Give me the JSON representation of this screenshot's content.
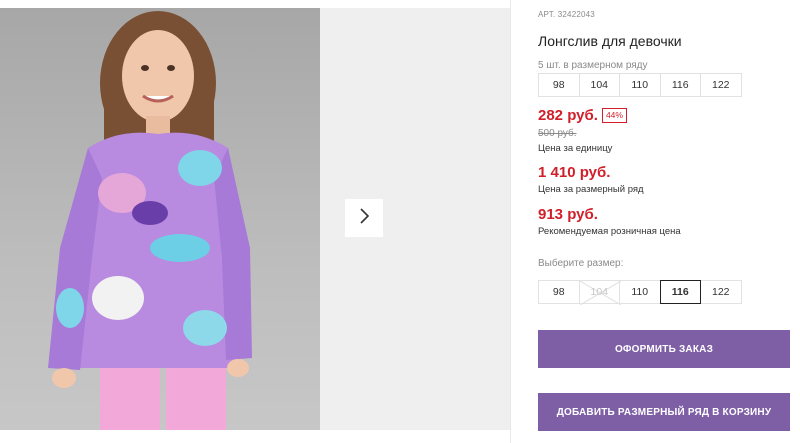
{
  "product": {
    "sku_label": "АРТ. 32422043",
    "title": "Лонгслив для девочки",
    "size_range_label": "5 шт. в размерном ряду",
    "size_range": [
      "98",
      "104",
      "110",
      "116",
      "122"
    ],
    "price": "282 руб.",
    "discount": "44%",
    "old_price": "500 руб.",
    "price_caption": "Цена за единицу",
    "range_price": "1 410 руб.",
    "range_price_caption": "Цена за размерный ряд",
    "retail_price": "913 руб.",
    "retail_price_caption": "Рекомендуемая розничная цена"
  },
  "size_picker": {
    "label": "Выберите размер:",
    "options": [
      {
        "label": "98",
        "state": "available"
      },
      {
        "label": "104",
        "state": "disabled"
      },
      {
        "label": "110",
        "state": "available"
      },
      {
        "label": "116",
        "state": "selected"
      },
      {
        "label": "122",
        "state": "available"
      }
    ]
  },
  "actions": {
    "order_button": "ОФОРМИТЬ ЗАКАЗ",
    "add_range_button": "ДОБАВИТЬ РАЗМЕРНЫЙ РЯД В КОРЗИНУ"
  },
  "gallery": {
    "next_icon": "chevron-right-icon"
  },
  "colors": {
    "accent": "#7e5fa6",
    "price": "#d01f2a",
    "muted": "#8a8a8a"
  }
}
